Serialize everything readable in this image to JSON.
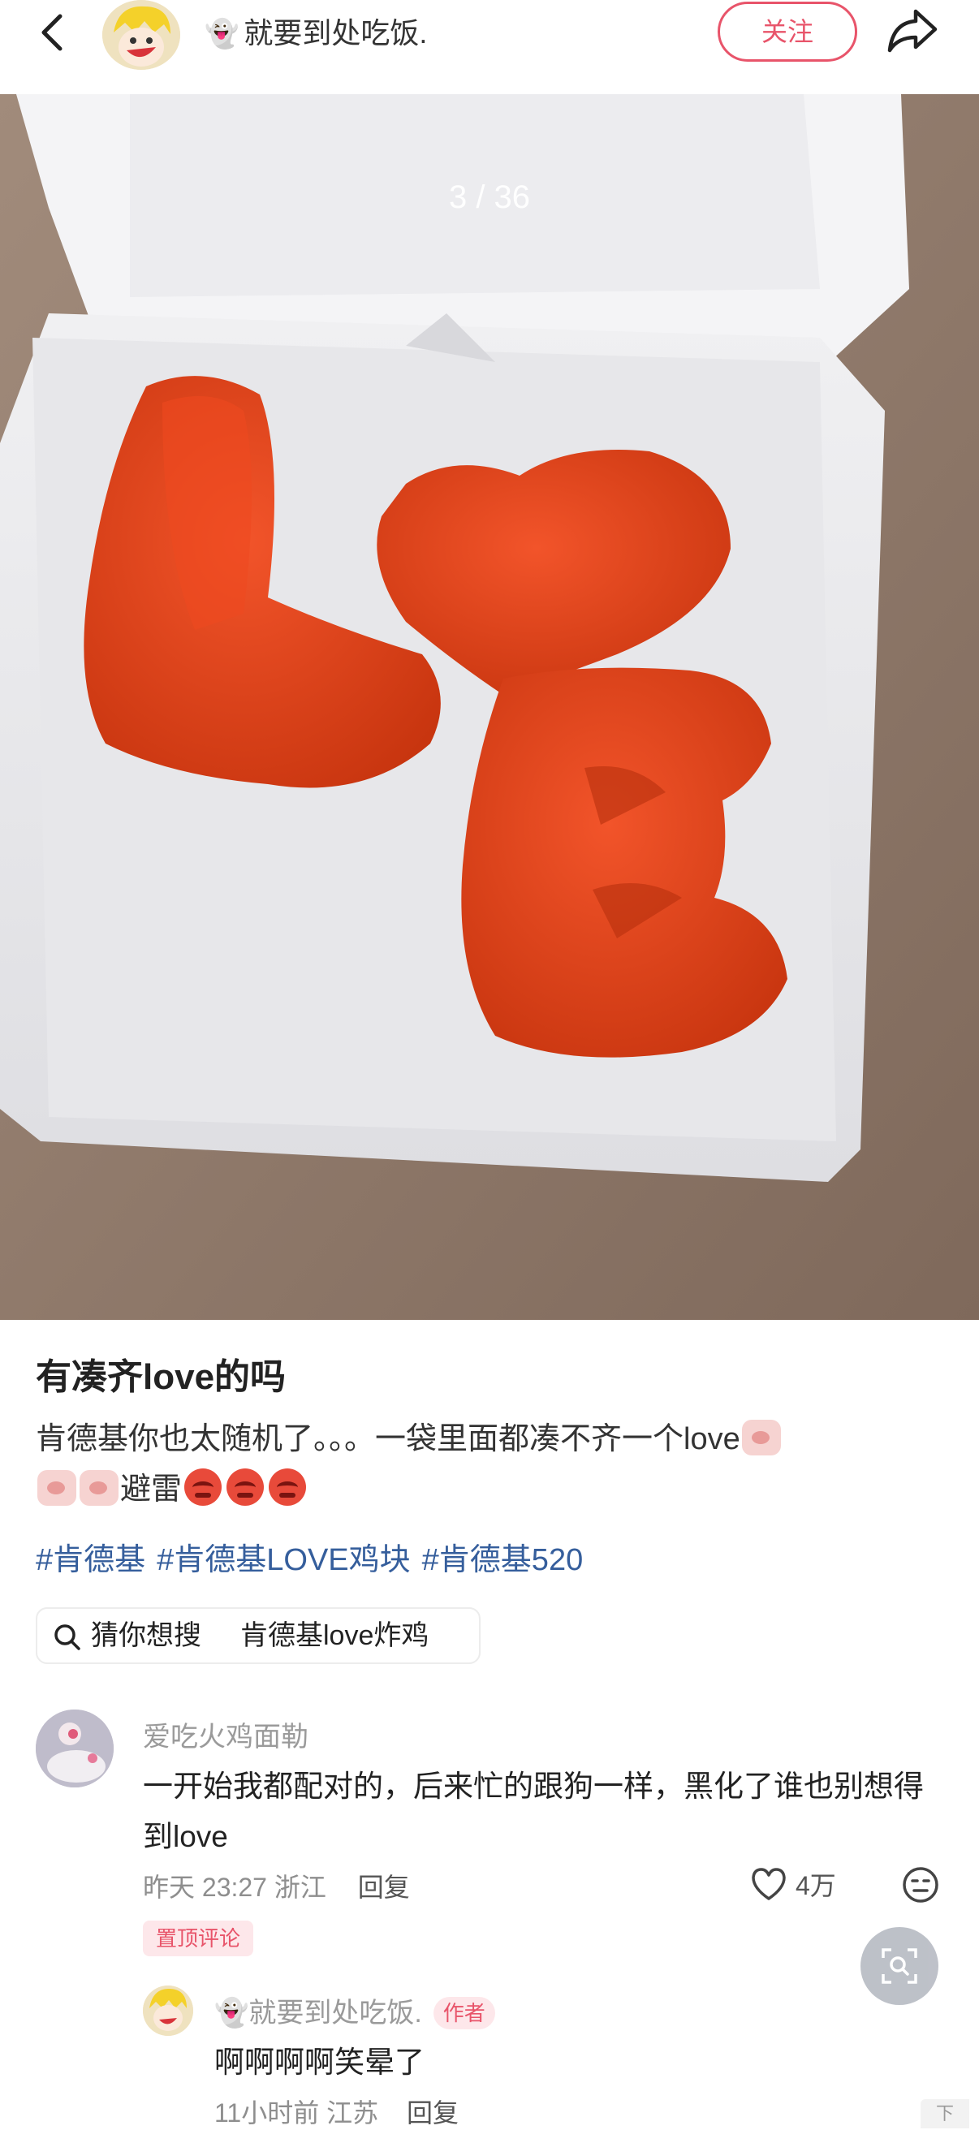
{
  "header": {
    "back_icon": "chevron-left-icon",
    "author_ghost_emoji": "👻",
    "author_name": "就要到处吃饭.",
    "follow_label": "关注",
    "share_icon": "share-arrow-icon"
  },
  "photo": {
    "page_indicator": "3 / 36",
    "description_icon": "chicken-nuggets-photo"
  },
  "post": {
    "title": "有凑齐love的吗",
    "body_part1": "肯德基你也太随机了。。。一袋里面都凑不齐一个love",
    "body_part2": "避雷",
    "hashtags": [
      "#肯德基",
      "#肯德基LOVE鸡块",
      "#肯德基520"
    ]
  },
  "search_suggest": {
    "icon": "search-icon",
    "label": "猜你想搜",
    "query": "肯德基love炸鸡"
  },
  "comment": {
    "user": "爱吃火鸡面勒",
    "text": "一开始我都配对的，后来忙的跟狗一样，黑化了谁也别想得到love",
    "time": "昨天 23:27",
    "location": "浙江",
    "reply_label": "回复",
    "like_count": "4万",
    "pin_label": "置顶评论"
  },
  "reply": {
    "ghost_emoji": "👻",
    "user": "就要到处吃饭.",
    "author_tag": "作者",
    "text": "啊啊啊啊笑晕了",
    "time": "11小时前",
    "location": "江苏",
    "reply_label": "回复"
  },
  "corner_label": "下",
  "colors": {
    "accent": "#e8546a",
    "hashtag": "#355e9c",
    "meta": "#8e8e8e"
  }
}
